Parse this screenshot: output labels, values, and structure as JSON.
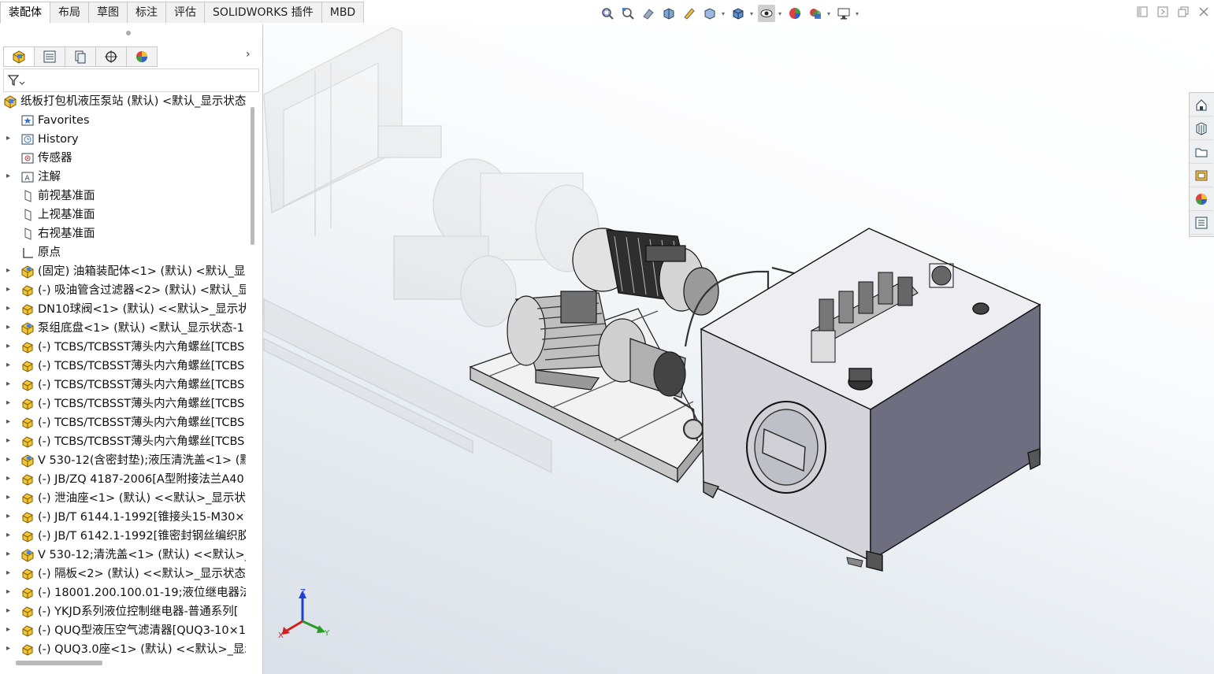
{
  "command_tabs": [
    "装配体",
    "布局",
    "草图",
    "标注",
    "评估",
    "SOLIDWORKS 插件",
    "MBD"
  ],
  "active_tab": "装配体",
  "view_toolbar": [
    "zoom-to-fit-icon",
    "zoom-to-area-icon",
    "previous-view-icon",
    "section-view-icon",
    "dynamic-annotation-icon",
    "view-orientation-icon",
    "display-style-icon",
    "hide-show-items-icon",
    "edit-appearance-icon",
    "apply-scene-icon",
    "view-settings-icon"
  ],
  "window_controls": [
    "tile-icon",
    "tile-right-icon",
    "restore-icon",
    "close-icon"
  ],
  "feature_manager_tabs": [
    "featuremanager-tree-icon",
    "property-manager-icon",
    "configuration-manager-icon",
    "dimxpert-icon",
    "display-manager-icon"
  ],
  "tree": {
    "items": [
      {
        "label": "纸板打包机液压泵站 (默认) <默认_显示状态",
        "icon": "assembly-icon",
        "caret": ""
      },
      {
        "label": "Favorites",
        "icon": "favorites-folder-icon",
        "caret": ""
      },
      {
        "label": "History",
        "icon": "history-folder-icon",
        "caret": "▸"
      },
      {
        "label": "传感器",
        "icon": "sensor-folder-icon",
        "caret": ""
      },
      {
        "label": "注解",
        "icon": "annotations-folder-icon",
        "caret": "▸"
      },
      {
        "label": "前视基准面",
        "icon": "plane-icon",
        "caret": ""
      },
      {
        "label": "上视基准面",
        "icon": "plane-icon",
        "caret": ""
      },
      {
        "label": "右视基准面",
        "icon": "plane-icon",
        "caret": ""
      },
      {
        "label": "原点",
        "icon": "origin-icon",
        "caret": ""
      },
      {
        "label": "(固定) 油箱装配体<1> (默认) <默认_显",
        "icon": "subassembly-icon",
        "caret": "▸"
      },
      {
        "label": "(-) 吸油管含过滤器<2> (默认) <默认_显",
        "icon": "part-icon",
        "caret": "▸"
      },
      {
        "label": "DN10球阀<1> (默认) <<默认>_显示状",
        "icon": "part-icon",
        "caret": "▸"
      },
      {
        "label": "泵组底盘<1> (默认) <默认_显示状态-1",
        "icon": "subassembly-icon",
        "caret": "▸"
      },
      {
        "label": "(-) TCBS/TCBSST薄头内六角螺丝[TCBS",
        "icon": "part-icon",
        "caret": "▸"
      },
      {
        "label": "(-) TCBS/TCBSST薄头内六角螺丝[TCBS",
        "icon": "part-icon",
        "caret": "▸"
      },
      {
        "label": "(-) TCBS/TCBSST薄头内六角螺丝[TCBS",
        "icon": "part-icon",
        "caret": "▸"
      },
      {
        "label": "(-) TCBS/TCBSST薄头内六角螺丝[TCBS",
        "icon": "part-icon",
        "caret": "▸"
      },
      {
        "label": "(-) TCBS/TCBSST薄头内六角螺丝[TCBS",
        "icon": "part-icon",
        "caret": "▸"
      },
      {
        "label": "(-) TCBS/TCBSST薄头内六角螺丝[TCBS",
        "icon": "part-icon",
        "caret": "▸"
      },
      {
        "label": "V 530-12(含密封垫);液压清洗盖<1> (默",
        "icon": "subassembly-icon",
        "caret": "▸"
      },
      {
        "label": "(-) JB/ZQ 4187-2006[A型附接法兰A40",
        "icon": "part-icon",
        "caret": "▸"
      },
      {
        "label": "(-) 泄油座<1> (默认) <<默认>_显示状",
        "icon": "part-icon",
        "caret": "▸"
      },
      {
        "label": "(-) JB/T 6144.1-1992[锥接头15-M30×",
        "icon": "part-icon",
        "caret": "▸"
      },
      {
        "label": "(-) JB/T 6142.1-1992[锥密封钢丝编织胶",
        "icon": "part-icon",
        "caret": "▸"
      },
      {
        "label": "V 530-12;清洗盖<1> (默认) <<默认>_",
        "icon": "subassembly-icon",
        "caret": "▸"
      },
      {
        "label": "(-) 隔板<2> (默认) <<默认>_显示状态",
        "icon": "part-icon",
        "caret": "▸"
      },
      {
        "label": "(-) 18001.200.100.01-19;液位继电器法",
        "icon": "part-icon",
        "caret": "▸"
      },
      {
        "label": "(-) YKJD系列液位控制继电器-普通系列[",
        "icon": "part-icon",
        "caret": "▸"
      },
      {
        "label": "(-) QUQ型液压空气滤清器[QUQ3-10×1",
        "icon": "part-icon",
        "caret": "▸"
      },
      {
        "label": "(-) QUQ3.0座<1> (默认) <<默认>_显示",
        "icon": "part-icon",
        "caret": "▸"
      }
    ]
  },
  "task_pane": [
    "solidworks-resources-icon",
    "design-library-icon",
    "file-explorer-icon",
    "view-palette-icon",
    "appearances-icon",
    "custom-properties-icon"
  ],
  "triad": {
    "x_label": "X",
    "y_label": "Y",
    "z_label": "Z"
  },
  "colors": {
    "axis_x": "#d22020",
    "axis_y": "#2a9a2a",
    "axis_z": "#1f3fd0",
    "tank": "#cfd1d8",
    "steel": "#8f929c"
  }
}
